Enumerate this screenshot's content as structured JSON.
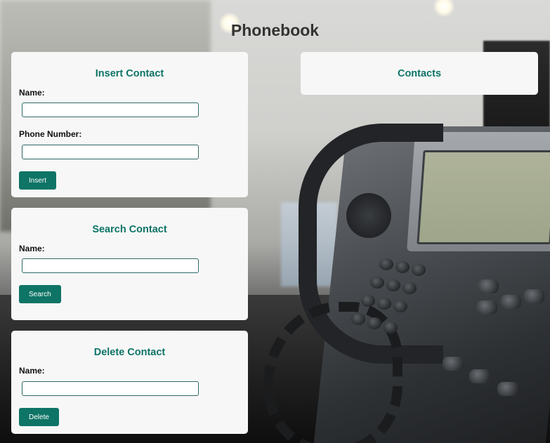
{
  "page": {
    "title": "Phonebook"
  },
  "insert_contact": {
    "title": "Insert Contact",
    "name_label": "Name:",
    "name_value": "",
    "phone_label": "Phone Number:",
    "phone_value": "",
    "button_label": "Insert"
  },
  "search_contact": {
    "title": "Search Contact",
    "name_label": "Name:",
    "name_value": "",
    "button_label": "Search"
  },
  "delete_contact": {
    "title": "Delete Contact",
    "name_label": "Name:",
    "name_value": "",
    "button_label": "Delete"
  },
  "contacts": {
    "title": "Contacts"
  },
  "colors": {
    "accent": "#0e7466",
    "card_background": "#f7f7f7",
    "title_text": "#333333",
    "input_border": "#2f6a66"
  }
}
